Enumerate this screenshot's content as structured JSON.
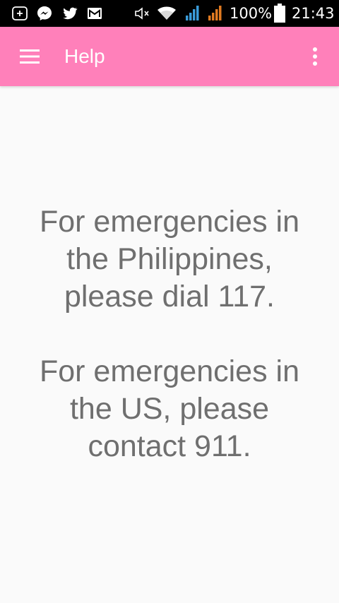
{
  "status_bar": {
    "icons": [
      "add-box-icon",
      "messenger-icon",
      "twitter-icon",
      "gmail-icon",
      "mute-icon",
      "wifi-icon",
      "signal-sim1-icon",
      "signal-sim2-icon",
      "battery-icon"
    ],
    "battery_percent": "100%",
    "time": "21:43"
  },
  "app_bar": {
    "title": "Help",
    "color": "#ff80ba"
  },
  "content": {
    "message_ph": "For emergencies in\nthe Philippines,\nplease dial 117.",
    "message_us": "For emergencies in\nthe US, please\ncontact 911."
  }
}
